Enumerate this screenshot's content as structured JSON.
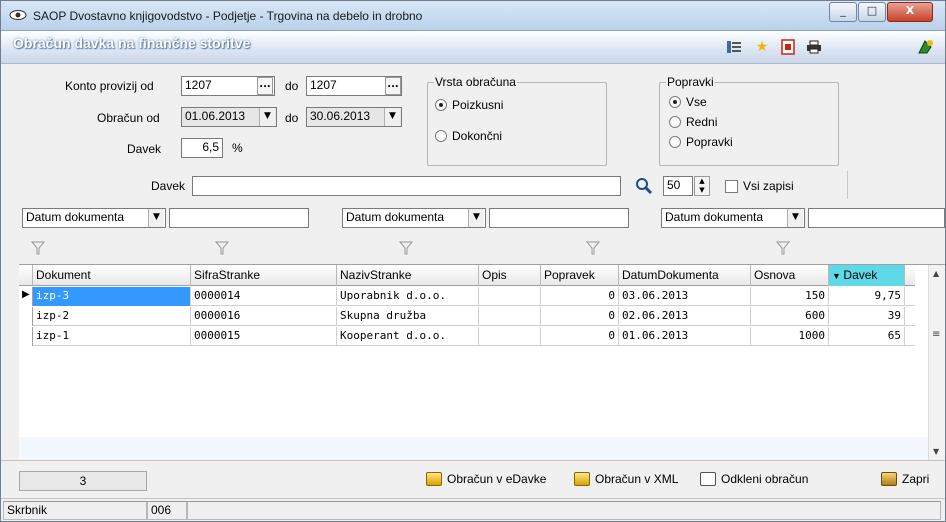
{
  "window": {
    "title": "SAOP Dvostavno knjigovodstvo - Podjetje - Trgovina na debelo in drobno",
    "min_label": "_",
    "max_label": "□",
    "close_label": "X"
  },
  "header": {
    "title": "Obračun davka na finančne storitve"
  },
  "form": {
    "konto_label": "Konto provizij od",
    "konto_from": "1207",
    "konto_do_label": "do",
    "konto_to": "1207",
    "obracun_label": "Obračun od",
    "obracun_from": "01.06.2013",
    "obracun_do_label": "do",
    "obracun_to": "30.06.2013",
    "davek_label": "Davek",
    "davek_value": "6,5",
    "davek_unit": "%",
    "ellipsis": "..."
  },
  "vrsta": {
    "title": "Vrsta obračuna",
    "options": [
      "Poizkusni",
      "Dokončni"
    ],
    "selected": "Poizkusni"
  },
  "popravki": {
    "title": "Popravki",
    "options": [
      "Vse",
      "Redni",
      "Popravki"
    ],
    "selected": "Vse"
  },
  "search": {
    "label": "Davek",
    "value": "",
    "count": "50",
    "vsi_zapisi_label": "Vsi zapisi"
  },
  "filters": {
    "dropdowns": [
      "Datum dokumenta",
      "Datum dokumenta",
      "Datum dokumenta"
    ]
  },
  "table": {
    "columns": [
      "Dokument",
      "SifraStranke",
      "NazivStranke",
      "Opis",
      "Popravek",
      "DatumDokumenta",
      "Osnova",
      "Davek"
    ],
    "sorted_column": "Davek",
    "rows": [
      {
        "dokument": "izp-3",
        "sifra": "0000014",
        "naziv": "Uporabnik d.o.o.",
        "opis": "",
        "popravek": "0",
        "datum": "03.06.2013",
        "osnova": "150",
        "davek": "9,75"
      },
      {
        "dokument": "izp-2",
        "sifra": "0000016",
        "naziv": "Skupna družba",
        "opis": "",
        "popravek": "0",
        "datum": "02.06.2013",
        "osnova": "600",
        "davek": "39"
      },
      {
        "dokument": "izp-1",
        "sifra": "0000015",
        "naziv": "Kooperant d.o.o.",
        "opis": "",
        "popravek": "0",
        "datum": "01.06.2013",
        "osnova": "1000",
        "davek": "65"
      }
    ]
  },
  "footer": {
    "record_count": "3",
    "btn_edavke": "Obračun v eDavke",
    "btn_xml": "Obračun v XML",
    "btn_odkleni": "Odkleni obračun",
    "btn_zapri": "Zapri"
  },
  "status": {
    "user_label": "Skrbnik",
    "user_code": "006"
  },
  "colors": {
    "sorted_header": "#5fd9e8",
    "selection": "#3399ff"
  }
}
